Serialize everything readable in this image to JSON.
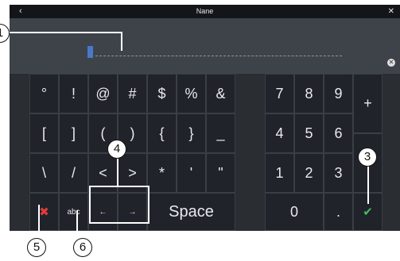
{
  "titlebar": {
    "title": "Nane",
    "back": "‹",
    "close": "✕"
  },
  "input": {
    "clear": "✕"
  },
  "keyboard": {
    "symbols": [
      [
        "°",
        "!",
        "@",
        "#",
        "$",
        "%",
        "&"
      ],
      [
        "[",
        "]",
        "(",
        ")",
        "{",
        "}",
        "_"
      ],
      [
        "\\",
        "/",
        "<",
        ">",
        "*",
        "'",
        "\""
      ]
    ],
    "bottom": {
      "cancel": "✖",
      "abc": "abc",
      "left": "←",
      "right": "→",
      "space": "Space"
    },
    "numpad": [
      [
        "7",
        "8",
        "9"
      ],
      [
        "4",
        "5",
        "6"
      ],
      [
        "1",
        "2",
        "3"
      ]
    ],
    "zero": "0",
    "dot": ".",
    "plus": "+",
    "minus": "-",
    "ok": "✔"
  },
  "callouts": {
    "c1": "1",
    "c3": "3",
    "c4": "4",
    "c5": "5",
    "c6": "6"
  }
}
